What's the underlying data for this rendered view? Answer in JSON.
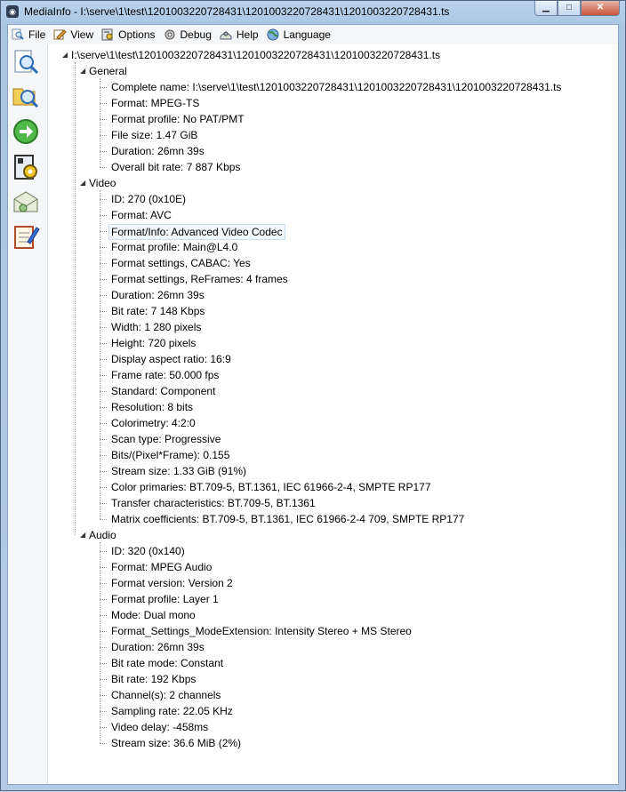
{
  "window": {
    "title": "MediaInfo - I:\\serve\\1\\test\\1201003220728431\\1201003220728431\\1201003220728431.ts",
    "min_glyph": "▁",
    "max_glyph": "□",
    "close_glyph": "✕"
  },
  "menu": {
    "items": [
      {
        "label": "File",
        "icon": "file-search-icon"
      },
      {
        "label": "View",
        "icon": "view-icon"
      },
      {
        "label": "Options",
        "icon": "options-icon"
      },
      {
        "label": "Debug",
        "icon": "debug-icon"
      },
      {
        "label": "Help",
        "icon": "help-icon"
      },
      {
        "label": "Language",
        "icon": "globe-icon"
      }
    ]
  },
  "toolbar": {
    "buttons": [
      "open-file-icon",
      "open-folder-icon",
      "go-arrow-icon",
      "export-icon",
      "email-icon",
      "notepad-icon"
    ]
  },
  "tree": {
    "root": "I:\\serve\\1\\test\\1201003220728431\\1201003220728431\\1201003220728431.ts",
    "sections": [
      {
        "name": "General",
        "items": [
          "Complete name: I:\\serve\\1\\test\\1201003220728431\\1201003220728431\\1201003220728431.ts",
          "Format: MPEG-TS",
          "Format profile: No PAT/PMT",
          "File size: 1.47 GiB",
          "Duration: 26mn 39s",
          "Overall bit rate: 7 887 Kbps"
        ]
      },
      {
        "name": "Video",
        "items": [
          "ID: 270 (0x10E)",
          "Format: AVC",
          "Format/Info: Advanced Video Codec",
          "Format profile: Main@L4.0",
          "Format settings, CABAC: Yes",
          "Format settings, ReFrames: 4 frames",
          "Duration: 26mn 39s",
          "Bit rate: 7 148 Kbps",
          "Width: 1 280 pixels",
          "Height: 720 pixels",
          "Display aspect ratio: 16:9",
          "Frame rate: 50.000 fps",
          "Standard: Component",
          "Resolution: 8 bits",
          "Colorimetry: 4:2:0",
          "Scan type: Progressive",
          "Bits/(Pixel*Frame): 0.155",
          "Stream size: 1.33 GiB (91%)",
          "Color primaries: BT.709-5, BT.1361, IEC 61966-2-4, SMPTE RP177",
          "Transfer characteristics: BT.709-5, BT.1361",
          "Matrix coefficients: BT.709-5, BT.1361, IEC 61966-2-4 709, SMPTE RP177"
        ]
      },
      {
        "name": "Audio",
        "items": [
          "ID: 320 (0x140)",
          "Format: MPEG Audio",
          "Format version: Version 2",
          "Format profile: Layer 1",
          "Mode: Dual mono",
          "Format_Settings_ModeExtension: Intensity Stereo + MS Stereo",
          "Duration: 26mn 39s",
          "Bit rate mode: Constant",
          "Bit rate: 192 Kbps",
          "Channel(s): 2 channels",
          "Sampling rate: 22.05 KHz",
          "Video delay: -458ms",
          "Stream size: 36.6 MiB (2%)"
        ]
      }
    ],
    "selected_item": "Format/Info: Advanced Video Codec"
  }
}
